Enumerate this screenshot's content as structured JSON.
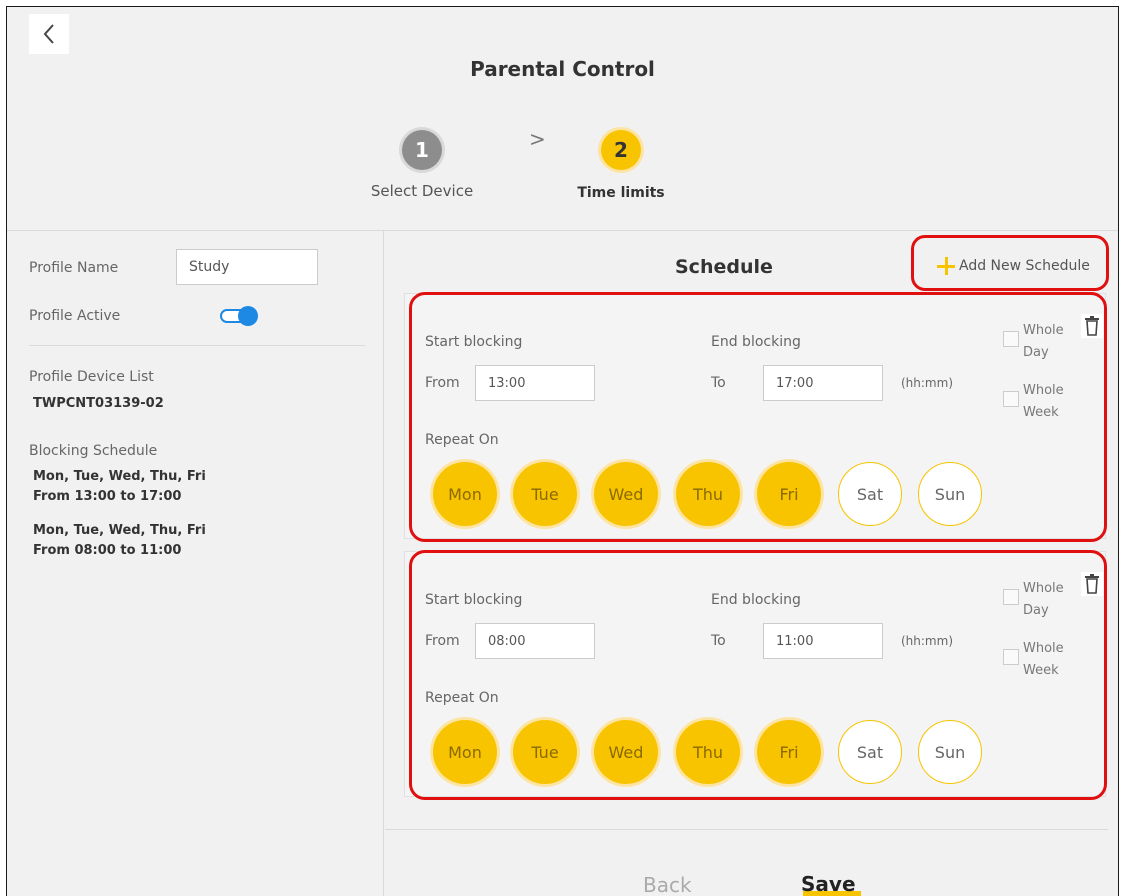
{
  "header": {
    "title": "Parental Control",
    "steps": [
      {
        "number": "1",
        "label": "Select Device"
      },
      {
        "number": "2",
        "label": "Time limits"
      }
    ],
    "step_separator": ">"
  },
  "profile": {
    "name_label": "Profile Name",
    "name_value": "Study",
    "active_label": "Profile Active",
    "active": true,
    "device_list_label": "Profile Device List",
    "device": "TWPCNT03139-02",
    "blocking_schedule_label": "Blocking Schedule",
    "blocking_schedules": [
      {
        "days": "Mon, Tue, Wed, Thu, Fri",
        "time": "From 13:00 to 17:00"
      },
      {
        "days": "Mon, Tue, Wed, Thu, Fri",
        "time": "From 08:00 to 11:00"
      }
    ]
  },
  "schedule": {
    "title": "Schedule",
    "add_label": "Add New Schedule",
    "start_label": "Start blocking",
    "end_label": "End blocking",
    "from_label": "From",
    "to_label": "To",
    "format_hint": "(hh:mm)",
    "whole_day_label": "Whole\nDay",
    "whole_week_label": "Whole\nWeek",
    "repeat_label": "Repeat On",
    "items": [
      {
        "from": "13:00",
        "to": "17:00",
        "whole_day": false,
        "whole_week": false,
        "days": [
          {
            "label": "Mon",
            "on": true
          },
          {
            "label": "Tue",
            "on": true
          },
          {
            "label": "Wed",
            "on": true
          },
          {
            "label": "Thu",
            "on": true
          },
          {
            "label": "Fri",
            "on": true
          },
          {
            "label": "Sat",
            "on": false
          },
          {
            "label": "Sun",
            "on": false
          }
        ]
      },
      {
        "from": "08:00",
        "to": "11:00",
        "whole_day": false,
        "whole_week": false,
        "days": [
          {
            "label": "Mon",
            "on": true
          },
          {
            "label": "Tue",
            "on": true
          },
          {
            "label": "Wed",
            "on": true
          },
          {
            "label": "Thu",
            "on": true
          },
          {
            "label": "Fri",
            "on": true
          },
          {
            "label": "Sat",
            "on": false
          },
          {
            "label": "Sun",
            "on": false
          }
        ]
      }
    ]
  },
  "footer": {
    "back_label": "Back",
    "save_label": "Save"
  },
  "colors": {
    "accent": "#f8c400",
    "toggle": "#1e88e5",
    "annotation": "#e01010"
  },
  "icons": [
    "chevron-left-icon",
    "plus-icon",
    "trash-icon"
  ]
}
